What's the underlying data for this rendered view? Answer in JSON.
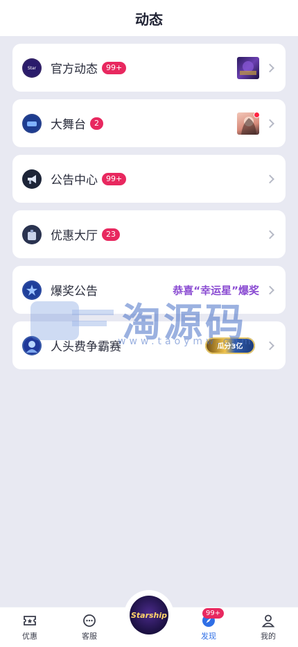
{
  "header": {
    "title": "动态"
  },
  "items": [
    {
      "label": "官方动态",
      "badge": "99+"
    },
    {
      "label": "大舞台",
      "badge": "2"
    },
    {
      "label": "公告中心",
      "badge": "99+"
    },
    {
      "label": "优惠大厅",
      "badge": "23"
    },
    {
      "label": "爆奖公告",
      "promo": "恭喜“幸运星”爆奖"
    },
    {
      "label": "人头费争霸赛",
      "event_badge": "瓜分3亿"
    }
  ],
  "watermark": {
    "text": "淘源码",
    "url": "www.taoymw.com"
  },
  "tabbar": {
    "tabs": [
      {
        "label": "优惠"
      },
      {
        "label": "客服"
      },
      {
        "label": "发现",
        "badge": "99+"
      },
      {
        "label": "我的"
      }
    ],
    "center_logo_text": "Starship"
  },
  "colors": {
    "badge": "#e8285f",
    "active_tab": "#2f6fe6",
    "promo": "#8a4bd2"
  }
}
